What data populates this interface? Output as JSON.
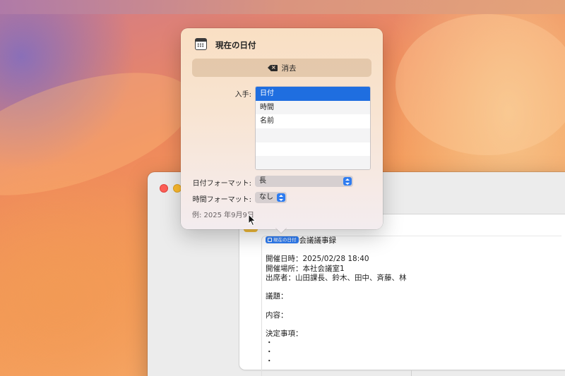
{
  "popover": {
    "title": "現在の日付",
    "icon": "calendar-icon",
    "clear_button_label": "消去",
    "clear_icon": "delete-backspace-icon",
    "source_label": "入手:",
    "source_items": [
      "日付",
      "時間",
      "名前",
      "",
      "",
      ""
    ],
    "selected_source": "日付",
    "date_format_label": "日付フォーマット:",
    "date_format_value": "長",
    "time_format_label": "時間フォーマット:",
    "time_format_value": "なし",
    "example_text": "例: 2025 年9月9日"
  },
  "document": {
    "token_label": "現在の日付",
    "title_suffix": "会議議事録",
    "lines": [
      "",
      "開催日時：2025/02/28 18:40",
      "開催場所：本社会議室1",
      "出席者：山田課長、鈴木、田中、斉藤、林",
      "",
      "議題：",
      "",
      "内容：",
      "",
      "決定事項：",
      "・",
      "・",
      "・"
    ]
  },
  "colors": {
    "accent": "#1f6ee0",
    "token": "#2f7cf0",
    "close": "#fe5f57",
    "minimize": "#febc2e"
  }
}
